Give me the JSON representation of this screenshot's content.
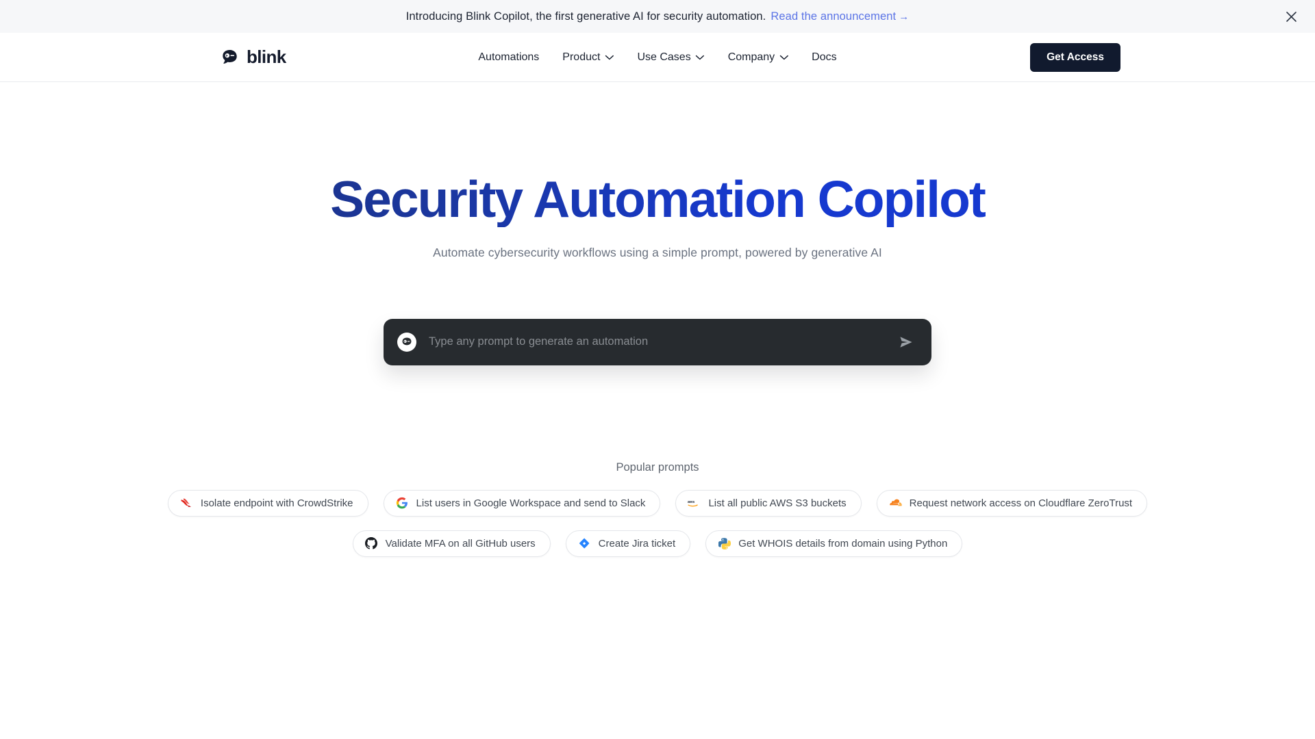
{
  "banner": {
    "text": "Introducing Blink Copilot, the first generative AI for security automation.",
    "link_text": "Read the announcement",
    "link_arrow": "→",
    "close_icon": "close-icon"
  },
  "header": {
    "logo_text": "blink",
    "logo_icon": "blink-ninja-logo-icon",
    "nav": [
      {
        "label": "Automations",
        "has_chevron": false
      },
      {
        "label": "Product",
        "has_chevron": true
      },
      {
        "label": "Use Cases",
        "has_chevron": true
      },
      {
        "label": "Company",
        "has_chevron": true
      },
      {
        "label": "Docs",
        "has_chevron": false
      }
    ],
    "cta_label": "Get Access"
  },
  "hero": {
    "title": "Security Automation Copilot",
    "subtitle": "Automate cybersecurity workflows using a simple prompt, powered by generative AI",
    "title_gradient_from": "#1b2d6b",
    "title_gradient_to": "#1639cf"
  },
  "prompt": {
    "placeholder": "Type any prompt to generate an automation",
    "value": "",
    "avatar_icon": "blink-ninja-avatar-icon",
    "send_icon": "send-icon",
    "background": "#272b2f"
  },
  "popular": {
    "label": "Popular prompts",
    "rows": [
      [
        {
          "label": "Isolate endpoint with CrowdStrike",
          "icon": "crowdstrike-icon"
        },
        {
          "label": "List users in Google Workspace and send to Slack",
          "icon": "google-icon"
        },
        {
          "label": "List all public AWS S3 buckets",
          "icon": "aws-icon"
        },
        {
          "label": "Request network access on Cloudflare ZeroTrust",
          "icon": "cloudflare-icon"
        }
      ],
      [
        {
          "label": "Validate MFA on all GitHub users",
          "icon": "github-icon"
        },
        {
          "label": "Create Jira ticket",
          "icon": "jira-icon"
        },
        {
          "label": "Get WHOIS details from domain using Python",
          "icon": "python-icon"
        }
      ]
    ]
  }
}
